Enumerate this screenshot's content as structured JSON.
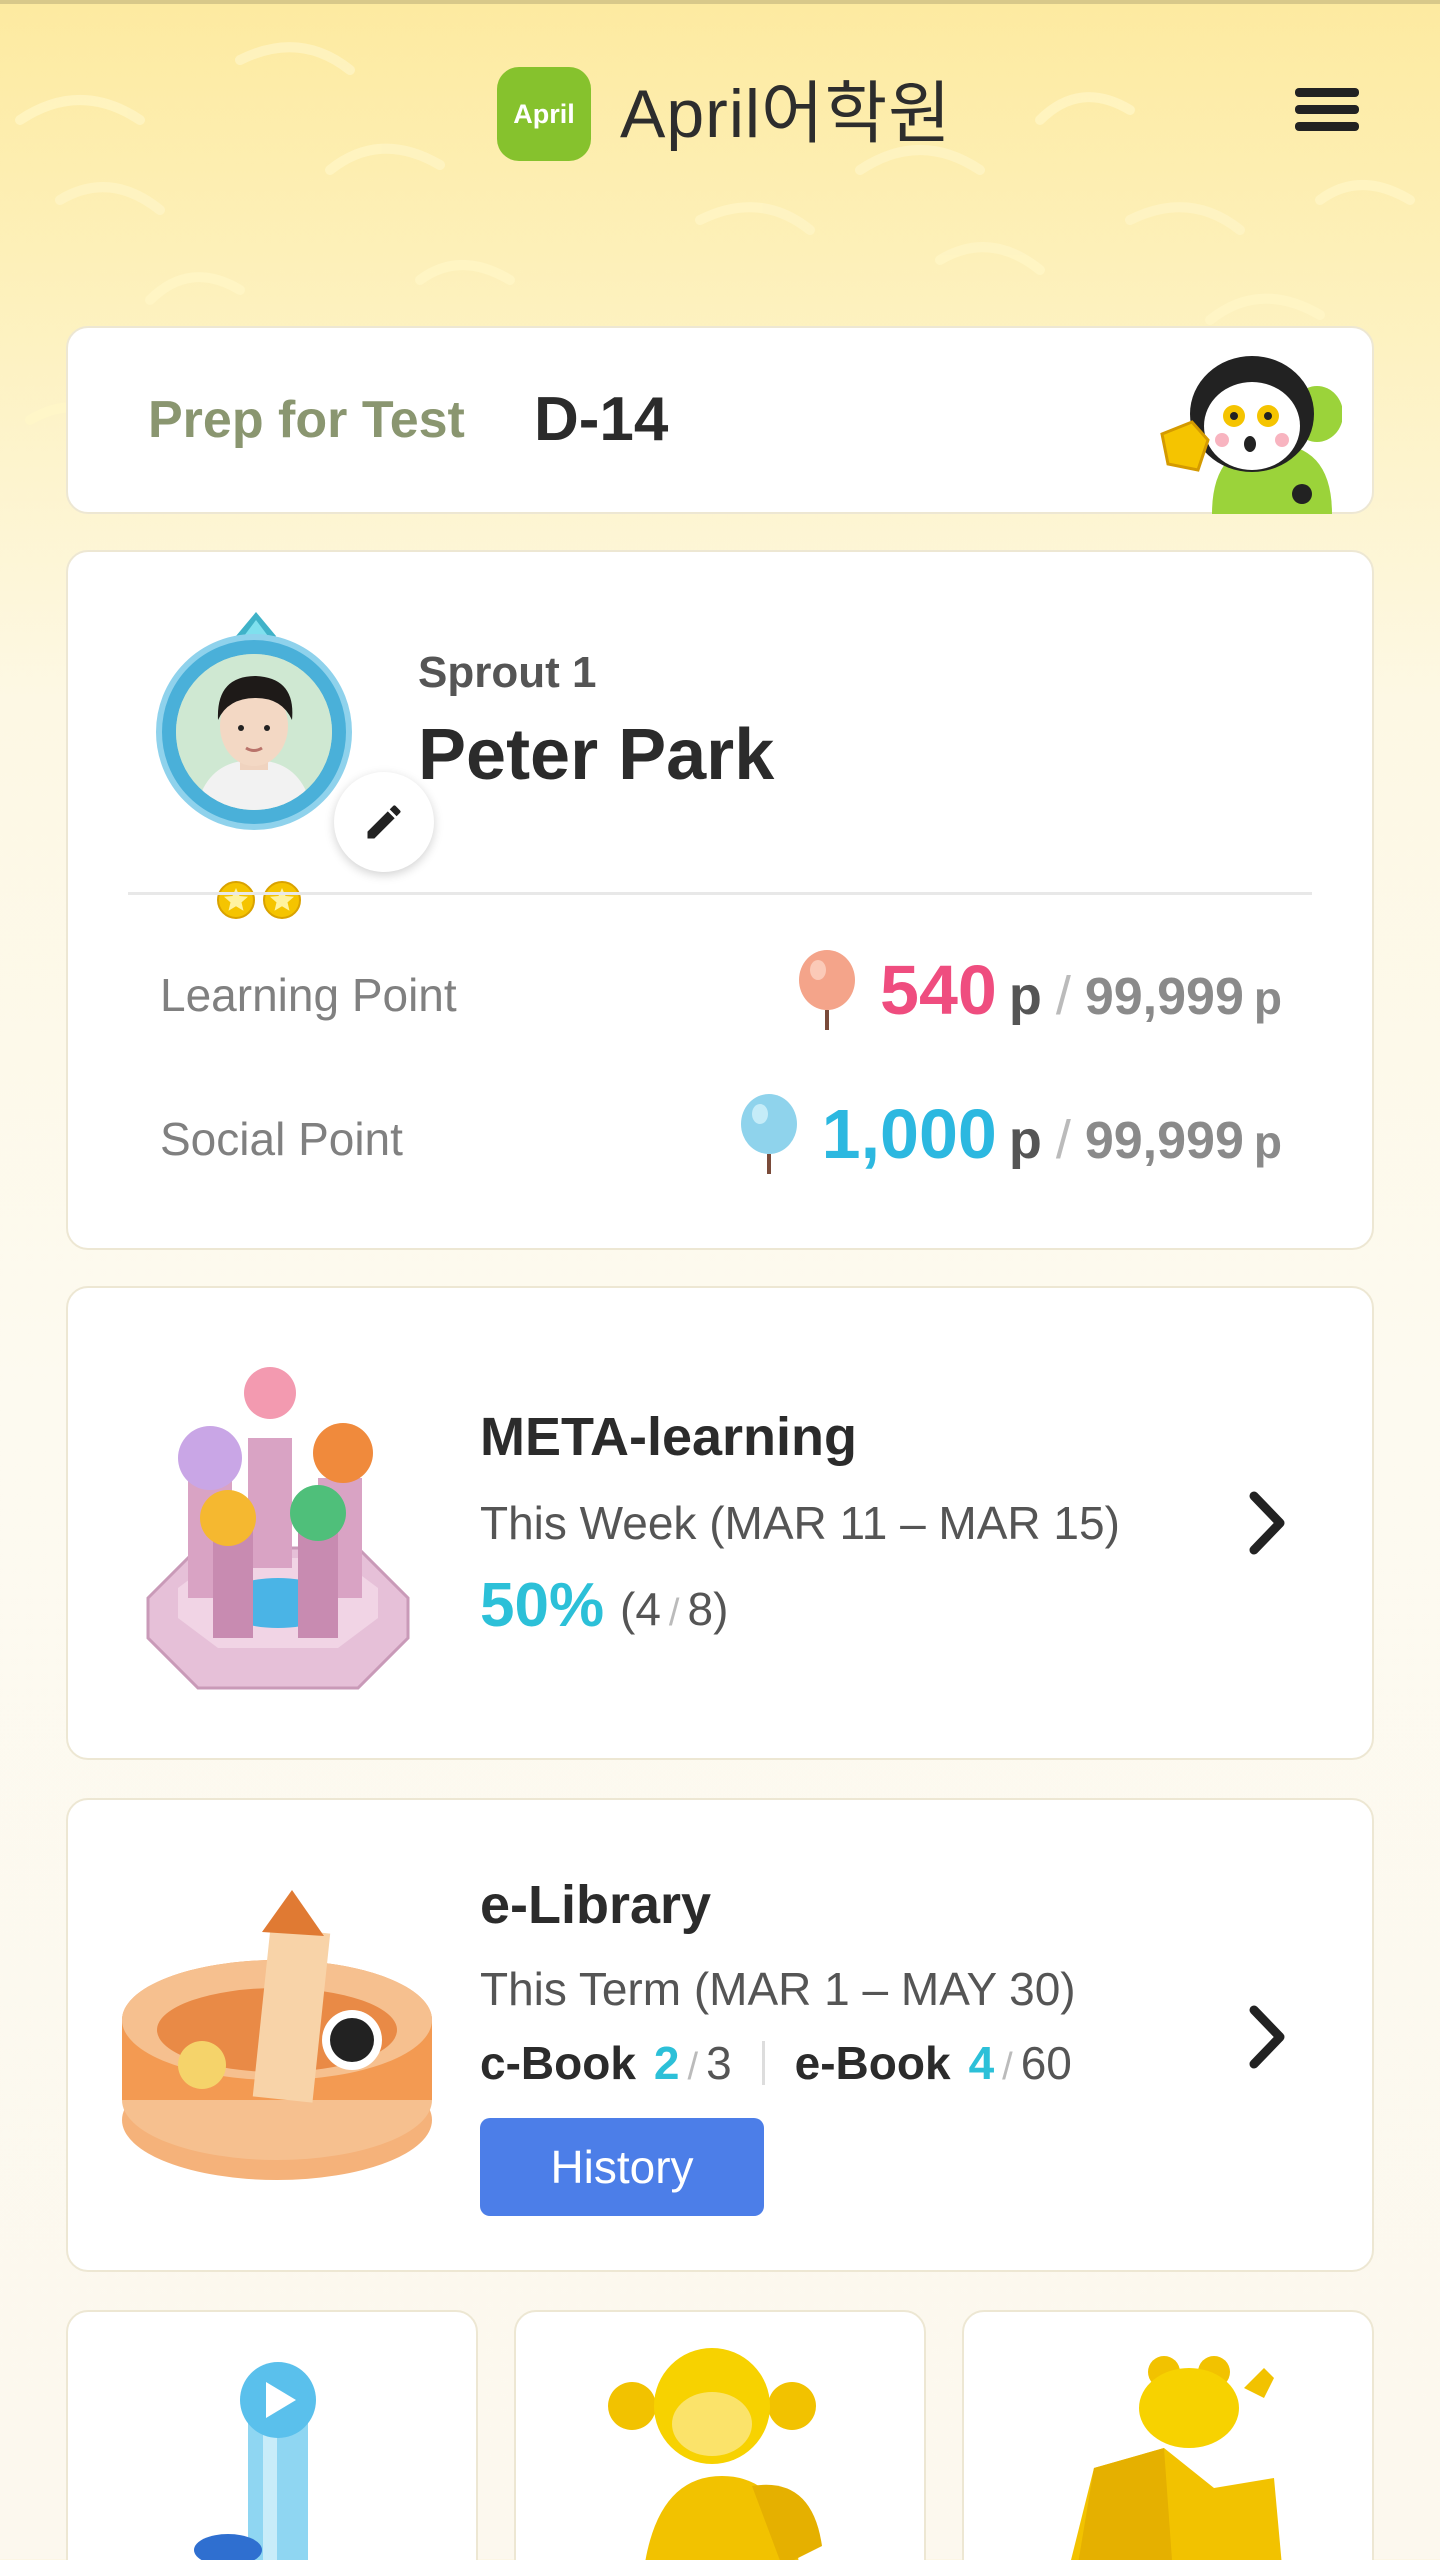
{
  "header": {
    "logo_badge": "April",
    "brand": "April어학원",
    "menu_icon": "hamburger-menu-icon"
  },
  "test_prep": {
    "label": "Prep for Test",
    "countdown": "D-14"
  },
  "profile": {
    "level": "Sprout 1",
    "name": "Peter Park",
    "stars": 2,
    "learning_point": {
      "label": "Learning Point",
      "value": "540",
      "unit": "p",
      "max": "99,999",
      "max_unit": "p",
      "color": "#ef4d7f"
    },
    "social_point": {
      "label": "Social Point",
      "value": "1,000",
      "unit": "p",
      "max": "99,999",
      "max_unit": "p",
      "color": "#2cb8e0"
    }
  },
  "meta_learning": {
    "title": "META-learning",
    "period": "This Week (MAR 11 – MAR 15)",
    "percent": "50%",
    "done": "4",
    "total": "8"
  },
  "e_library": {
    "title": "e-Library",
    "period": "This Term (MAR 1 – MAY 30)",
    "cbook_label": "c-Book",
    "cbook_done": "2",
    "cbook_total": "3",
    "ebook_label": "e-Book",
    "ebook_done": "4",
    "ebook_total": "60",
    "history_button": "History"
  },
  "colors": {
    "accent_blue": "#4c7ee8",
    "accent_cyan": "#2cc0d8",
    "brand_green": "#86c22d"
  }
}
